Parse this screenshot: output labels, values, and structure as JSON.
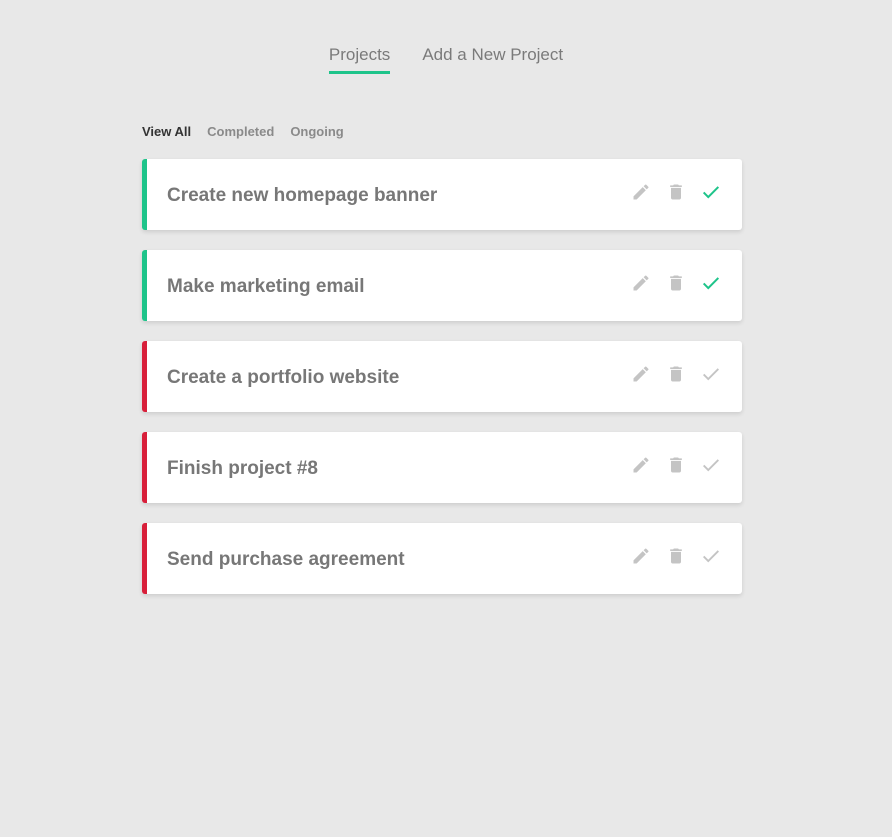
{
  "nav": {
    "tabs": [
      {
        "label": "Projects"
      },
      {
        "label": "Add a New Project"
      }
    ]
  },
  "filters": {
    "items": [
      {
        "label": "View All"
      },
      {
        "label": "Completed"
      },
      {
        "label": "Ongoing"
      }
    ]
  },
  "colors": {
    "complete_accent": "#1ec48a",
    "ongoing_accent": "#d81f3a",
    "icon_gray": "#c4c4c4",
    "background": "#e8e8e8"
  },
  "projects": [
    {
      "title": "Create new homepage banner",
      "status": "completed"
    },
    {
      "title": "Make marketing email",
      "status": "completed"
    },
    {
      "title": "Create a portfolio website",
      "status": "ongoing"
    },
    {
      "title": "Finish project #8",
      "status": "ongoing"
    },
    {
      "title": "Send purchase agreement",
      "status": "ongoing"
    }
  ],
  "icons": {
    "edit": "pencil-icon",
    "delete": "trash-icon",
    "complete": "check-icon"
  }
}
